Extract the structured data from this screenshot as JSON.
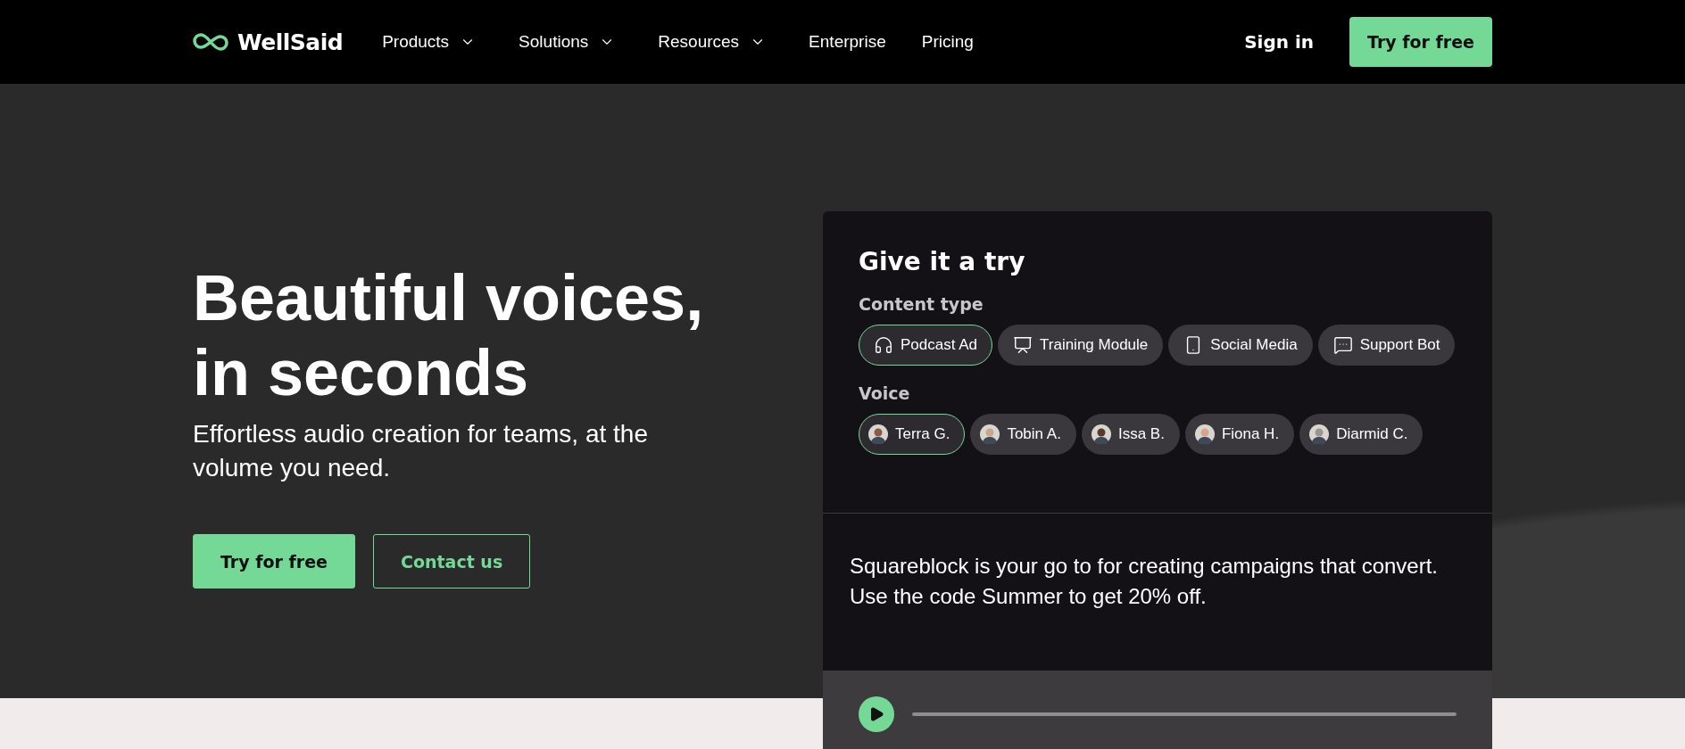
{
  "nav": {
    "logo": "WellSaid",
    "items": [
      {
        "label": "Products",
        "dropdown": true
      },
      {
        "label": "Solutions",
        "dropdown": true
      },
      {
        "label": "Resources",
        "dropdown": true
      },
      {
        "label": "Enterprise",
        "dropdown": false
      },
      {
        "label": "Pricing",
        "dropdown": false
      }
    ],
    "sign_in": "Sign in",
    "cta": "Try for free"
  },
  "hero": {
    "title_lines": [
      "Beautiful voices,",
      "in seconds"
    ],
    "subtitle": "Effortless audio creation for teams, at the volume you need.",
    "buttons": [
      {
        "label": "Try for free",
        "kind": "primary"
      },
      {
        "label": "Contact us",
        "kind": "outline"
      }
    ]
  },
  "demo": {
    "title": "Give it a try",
    "content_type_label": "Content type",
    "content_types": [
      {
        "label": "Podcast Ad",
        "kind": "headphones",
        "selected": true
      },
      {
        "label": "Training Module",
        "kind": "presentation",
        "selected": false
      },
      {
        "label": "Social Media",
        "kind": "phone",
        "selected": false
      },
      {
        "label": "Support Bot",
        "kind": "chat",
        "selected": false
      }
    ],
    "voice_label": "Voice",
    "voices": [
      {
        "name": "Terra G.",
        "selected": true
      },
      {
        "name": "Tobin A.",
        "selected": false
      },
      {
        "name": "Issa B.",
        "selected": false
      },
      {
        "name": "Fiona H.",
        "selected": false
      },
      {
        "name": "Diarmid C.",
        "selected": false
      }
    ],
    "script": "Squareblock is your go to for creating campaigns that convert. Use the code Summer to get 20% off."
  }
}
